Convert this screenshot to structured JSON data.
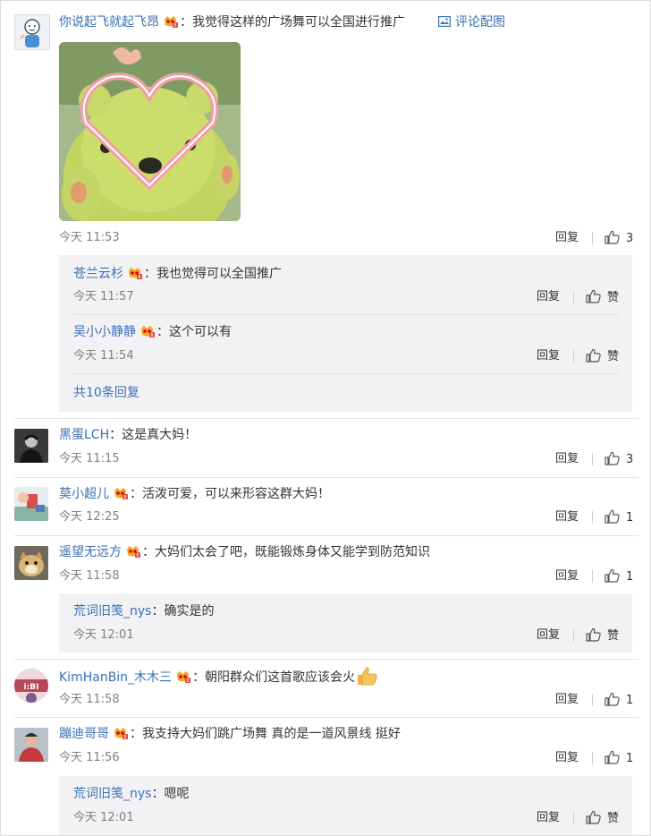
{
  "comments": [
    {
      "name": "你说起飞就起飞昂",
      "text": "：我觉得这样的广场舞可以全国进行推广",
      "eval_pic": "评论配图",
      "time": "今天 11:53",
      "reply": "回复",
      "likes": "3",
      "replies": [
        {
          "name": "苍兰云杉",
          "text": "：我也觉得可以全国推广",
          "time": "今天 11:57",
          "reply": "回复",
          "like": "赞"
        },
        {
          "name": "吴小小静静",
          "text": "：这个可以有",
          "time": "今天 11:54",
          "reply": "回复",
          "like": "赞"
        }
      ],
      "more": "共10条回复"
    },
    {
      "name": "黑蛋LCH",
      "text": "：这是真大妈！",
      "time": "今天 11:15",
      "reply": "回复",
      "likes": "3"
    },
    {
      "name": "莫小超儿",
      "text": "：活泼可爱，可以来形容这群大妈！",
      "time": "今天 12:25",
      "reply": "回复",
      "likes": "1"
    },
    {
      "name": "遥望无远方",
      "text": "：大妈们太会了吧，既能锻炼身体又能学到防范知识",
      "time": "今天 11:58",
      "reply": "回复",
      "likes": "1",
      "replies": [
        {
          "name": "荒词旧笺_nys",
          "text": "：确实是的",
          "time": "今天 12:01",
          "reply": "回复",
          "like": "赞"
        }
      ]
    },
    {
      "name": "KimHanBin_木木三",
      "text": "：朝阳群众们这首歌应该会火",
      "time": "今天 11:58",
      "reply": "回复",
      "likes": "1"
    },
    {
      "name": "蹦迪哥哥",
      "text": "：我支持大妈们跳广场舞 真的是一道风景线 挺好",
      "time": "今天 11:56",
      "reply": "回复",
      "likes": "1",
      "replies": [
        {
          "name": "荒词旧笺_nys",
          "text": "：嗯呢",
          "time": "今天 12:01",
          "reply": "回复",
          "like": "赞"
        }
      ]
    }
  ],
  "colors": {
    "link": "#3a6fb3",
    "time": "#808080",
    "reply_bg": "#f2f2f5"
  }
}
